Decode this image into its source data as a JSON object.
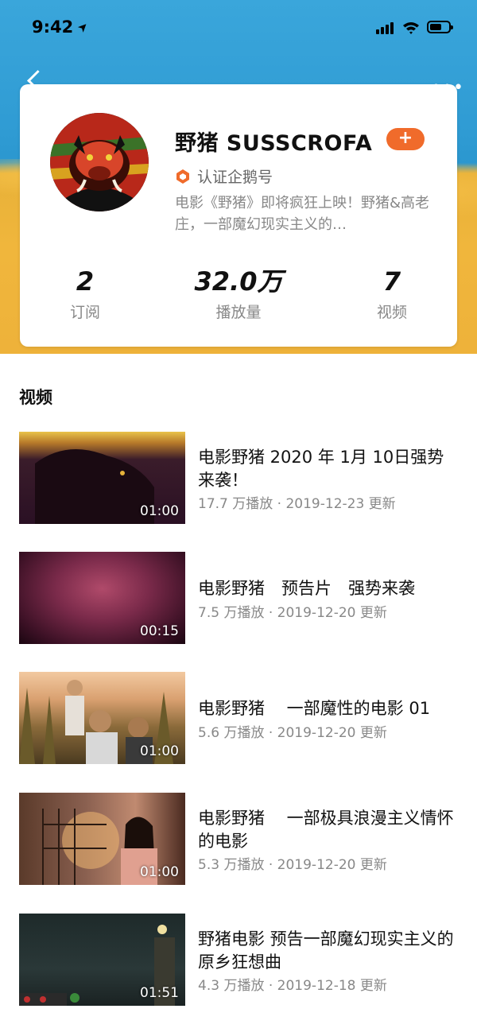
{
  "status_bar": {
    "time": "9:42",
    "location_glyph": "➤"
  },
  "header": {
    "more_label": "•••"
  },
  "channel": {
    "name": "野猪 SUSSCROFA",
    "follow_label": "+",
    "verified_label": "认证企鹅号",
    "description": "电影《野猪》即将疯狂上映！野猪&高老庄，一部魔幻现实主义的…",
    "stats": [
      {
        "value": "2",
        "label": "订阅"
      },
      {
        "value": "32.0万",
        "label": "播放量"
      },
      {
        "value": "7",
        "label": "视频"
      }
    ]
  },
  "section_title": "视频",
  "videos": [
    {
      "title": "电影野猪 2020 年 1月 10日强势来袭！",
      "views": "17.7 万播放",
      "date": "2019-12-23 更新",
      "duration": "01:00"
    },
    {
      "title": "电影野猪　预告片　强势来袭",
      "views": "7.5 万播放",
      "date": "2019-12-20 更新",
      "duration": "00:15"
    },
    {
      "title": "电影野猪　 一部魔性的电影 01",
      "views": "5.6 万播放",
      "date": "2019-12-20 更新",
      "duration": "01:00"
    },
    {
      "title": "电影野猪　 一部极具浪漫主义情怀的电影",
      "views": "5.3 万播放",
      "date": "2019-12-20 更新",
      "duration": "01:00"
    },
    {
      "title": "野猪电影 预告一部魔幻现实主义的原乡狂想曲",
      "views": "4.3 万播放",
      "date": "2019-12-18 更新",
      "duration": "01:51"
    }
  ],
  "colors": {
    "accent": "#f06b2b",
    "hero_sky": "#2f9bd3",
    "hero_sand": "#f0b63c"
  }
}
